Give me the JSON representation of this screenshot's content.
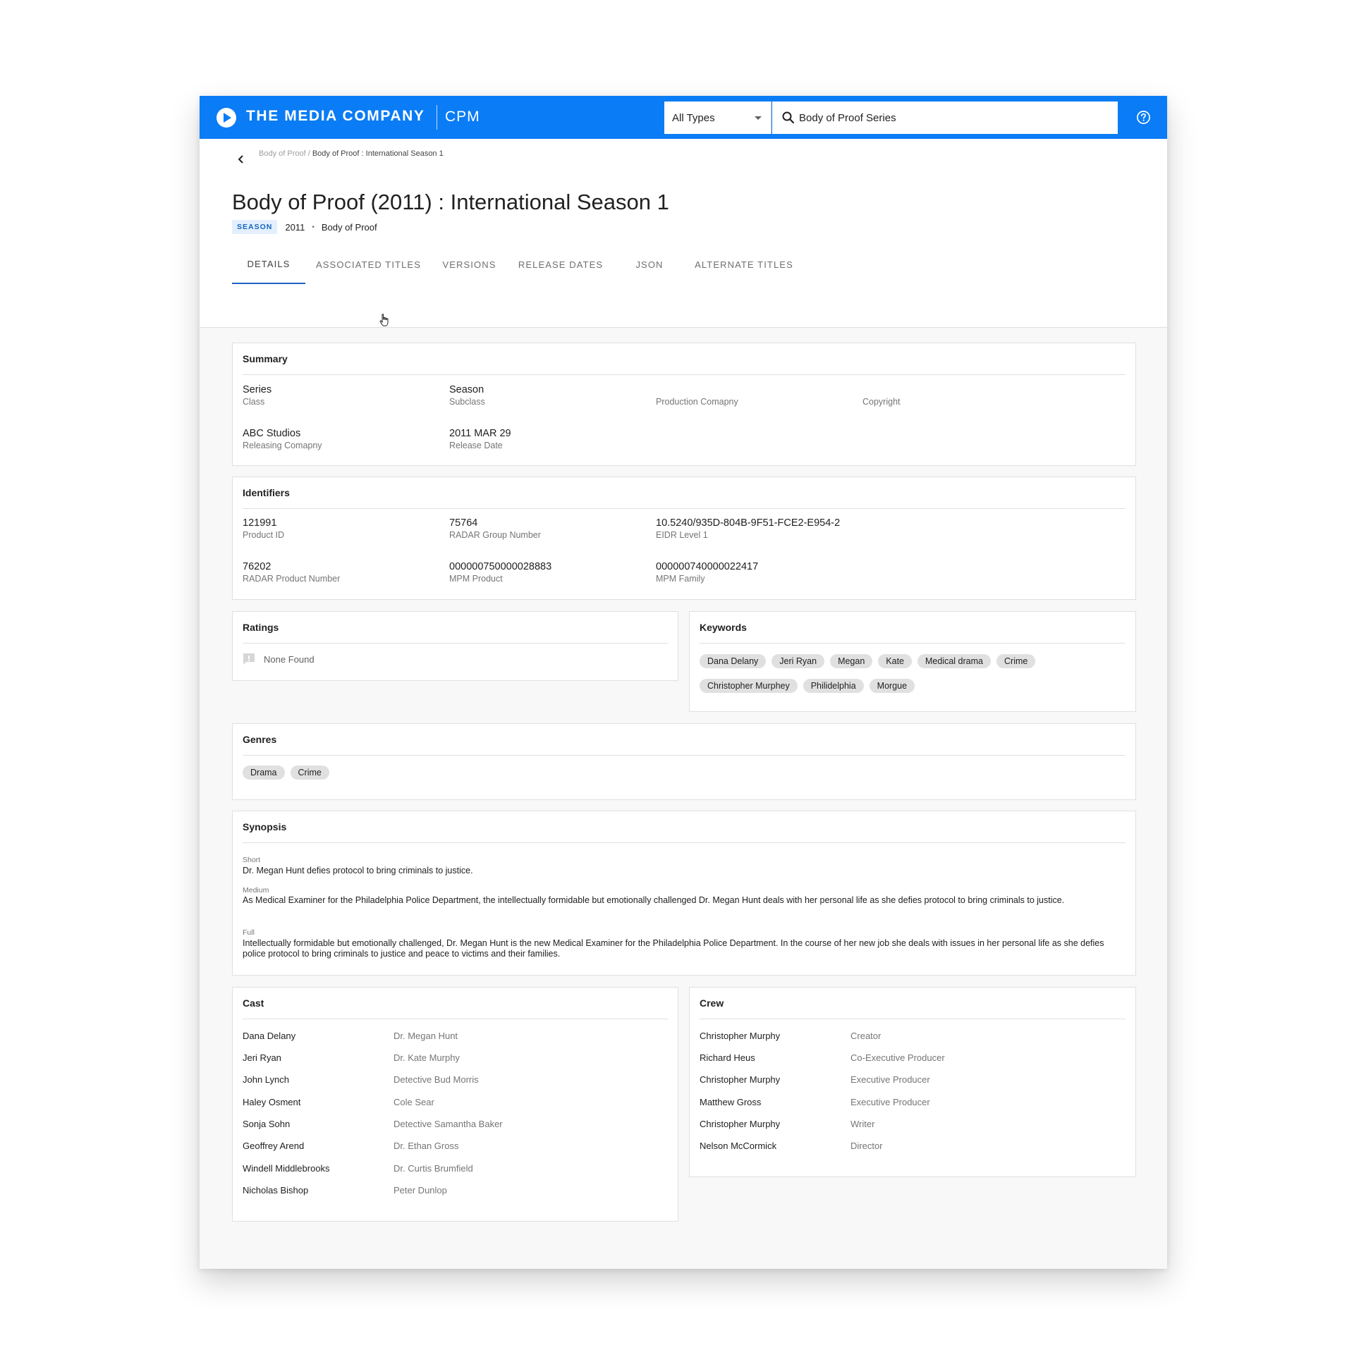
{
  "topbar": {
    "brand": "THE MEDIA COMPANY",
    "brand_sub": "CPM",
    "type_select": "All Types",
    "search_value": "Body of Proof Series",
    "accent": "#0a7cf5"
  },
  "breadcrumb": {
    "parent": "Body of Proof",
    "separator": " / ",
    "current": "Body of Proof : International Season 1"
  },
  "title": "Body of Proof (2011) : International Season 1",
  "meta": {
    "badge": "SEASON",
    "year": "2011",
    "dot": "•",
    "series": "Body of Proof"
  },
  "tabs": [
    {
      "label": "DETAILS",
      "active": true
    },
    {
      "label": "ASSOCIATED TITLES",
      "active": false
    },
    {
      "label": "VERSIONS",
      "active": false
    },
    {
      "label": "RELEASE DATES",
      "active": false
    },
    {
      "label": "JSON",
      "active": false
    },
    {
      "label": "ALTERNATE TITLES",
      "active": false
    }
  ],
  "summary": {
    "title": "Summary",
    "fields": [
      {
        "value": "Series",
        "label": "Class"
      },
      {
        "value": "Season",
        "label": "Subclass"
      },
      {
        "value": "",
        "label": "Production Comapny"
      },
      {
        "value": "",
        "label": "Copyright"
      },
      {
        "value": "ABC Studios",
        "label": "Releasing Comapny"
      },
      {
        "value": "2011 MAR 29",
        "label": "Release Date"
      }
    ]
  },
  "identifiers": {
    "title": "Identifiers",
    "fields": [
      {
        "value": "121991",
        "label": "Product ID"
      },
      {
        "value": "75764",
        "label": "RADAR Group Number"
      },
      {
        "value": "10.5240/935D-804B-9F51-FCE2-E954-2",
        "label": "EIDR Level 1"
      },
      {
        "value": "76202",
        "label": "RADAR Product Number"
      },
      {
        "value": "000000750000028883",
        "label": "MPM Product"
      },
      {
        "value": "000000740000022417",
        "label": "MPM Family"
      }
    ]
  },
  "ratings": {
    "title": "Ratings",
    "empty": "None Found"
  },
  "keywords": {
    "title": "Keywords",
    "items": [
      "Dana Delany",
      "Jeri Ryan",
      "Megan",
      "Kate",
      "Medical drama",
      "Crime",
      "Christopher Murphey",
      "Philidelphia",
      "Morgue"
    ]
  },
  "genres": {
    "title": "Genres",
    "items": [
      "Drama",
      "Crime"
    ]
  },
  "synopsis": {
    "title": "Synopsis",
    "short_label": "Short",
    "short": "Dr. Megan Hunt defies protocol to bring criminals to justice.",
    "medium_label": "Medium",
    "medium": "As Medical Examiner for the Philadelphia Police Department, the intellectually formidable but emotionally challenged Dr. Megan Hunt deals with her personal life as she defies protocol to bring criminals to justice.",
    "full_label": "Full",
    "full": "Intellectually formidable but emotionally challenged, Dr. Megan Hunt is the new Medical Examiner for the Philadelphia Police Department. In the course of her new job she deals with issues in her personal life as she defies police protocol to bring criminals to justice and peace to victims and their families."
  },
  "cast": {
    "title": "Cast",
    "rows": [
      {
        "name": "Dana Delany",
        "role": "Dr. Megan Hunt"
      },
      {
        "name": "Jeri Ryan",
        "role": "Dr. Kate Murphy"
      },
      {
        "name": "John Lynch",
        "role": "Detective Bud Morris"
      },
      {
        "name": "Haley Osment",
        "role": "Cole Sear"
      },
      {
        "name": "Sonja Sohn",
        "role": "Detective Samantha Baker"
      },
      {
        "name": "Geoffrey Arend",
        "role": "Dr. Ethan Gross"
      },
      {
        "name": "Windell Middlebrooks",
        "role": "Dr. Curtis Brumfield"
      },
      {
        "name": "Nicholas Bishop",
        "role": "Peter Dunlop"
      }
    ]
  },
  "crew": {
    "title": "Crew",
    "rows": [
      {
        "name": "Christopher Murphy",
        "role": "Creator"
      },
      {
        "name": "Richard Heus",
        "role": "Co-Executive Producer"
      },
      {
        "name": "Christopher Murphy",
        "role": "Executive Producer"
      },
      {
        "name": "Matthew Gross",
        "role": "Executive Producer"
      },
      {
        "name": "Christopher Murphy",
        "role": "Writer"
      },
      {
        "name": "Nelson McCormick",
        "role": "Director"
      }
    ]
  }
}
